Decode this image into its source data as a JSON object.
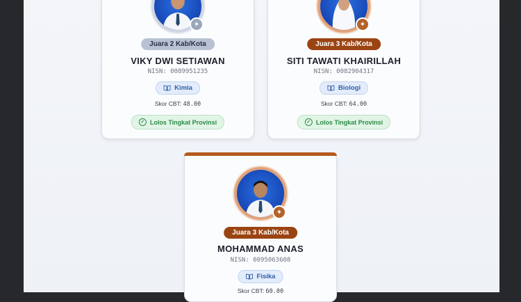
{
  "cards": [
    {
      "rank": "Juara 2 Kab/Kota",
      "name": "VIKY DWI SETIAWAN",
      "nisn": "NISN: 0089951235",
      "subject": "Kimia",
      "score_label": "Skor CBT:",
      "score_value": "48.00",
      "status": "Lolos Tingkat Provinsi",
      "medal_color": "#9aa7ba"
    },
    {
      "rank": "Juara 3 Kab/Kota",
      "name": "SITI TAWATI KHAIRILLAH",
      "nisn": "NISN: 0082904317",
      "subject": "Biologi",
      "score_label": "Skor CBT:",
      "score_value": "64.00",
      "status": "Lolos Tingkat Provinsi",
      "medal_color": "#b5622a"
    },
    {
      "rank": "Juara 3 Kab/Kota",
      "name": "MOHAMMAD ANAS",
      "nisn": "NISN: 0095063608",
      "subject": "Fisika",
      "score_label": "Skor CBT:",
      "score_value": "60.00",
      "medal_color": "#b5622a"
    }
  ],
  "icons": {
    "subject": "book-icon",
    "status": "check-circle-icon",
    "medal": "medal-icon"
  }
}
